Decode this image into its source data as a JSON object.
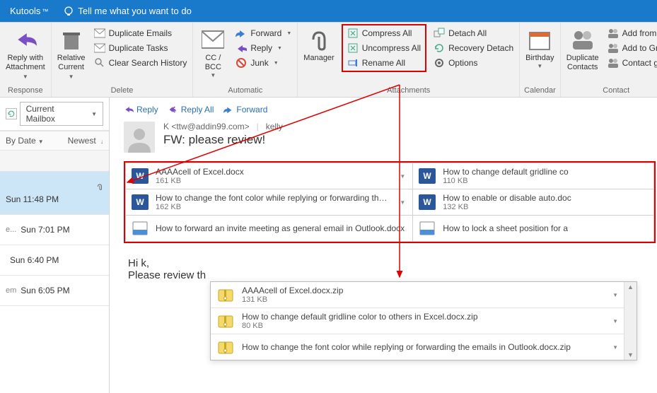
{
  "tabs": {
    "kutools": "Kutools",
    "tellme": "Tell me what you want to do"
  },
  "ribbon": {
    "response": {
      "label": "Response",
      "reply_with_attachment_l1": "Reply with",
      "reply_with_attachment_l2": "Attachment"
    },
    "delete": {
      "label": "Delete",
      "relative_current_l1": "Relative",
      "relative_current_l2": "Current",
      "duplicate_emails": "Duplicate Emails",
      "duplicate_tasks": "Duplicate Tasks",
      "clear_search_history": "Clear Search History"
    },
    "automatic": {
      "label": "Automatic",
      "ccbcc": "CC / BCC",
      "forward": "Forward",
      "reply": "Reply",
      "junk": "Junk"
    },
    "attachments": {
      "label": "Attachments",
      "manager": "Manager",
      "compress_all": "Compress All",
      "uncompress_all": "Uncompress All",
      "rename_all": "Rename All",
      "detach_all": "Detach All",
      "recovery_detach": "Recovery Detach",
      "options": "Options"
    },
    "calendar": {
      "label": "Calendar",
      "birthday": "Birthday"
    },
    "contact": {
      "label": "Contact",
      "duplicate_contacts_l1": "Duplicate",
      "duplicate_contacts_l2": "Contacts",
      "add_from": "Add from M",
      "add_to_gro": "Add to Gro",
      "contact_gro": "Contact gro"
    }
  },
  "mail_list": {
    "mailbox": "Current Mailbox",
    "sort_by": "By Date",
    "sort_dir": "Newest",
    "items": [
      {
        "time": "Sun 11:48 PM",
        "has_attach": true,
        "selected": true,
        "prefix": ""
      },
      {
        "time": "Sun 7:01 PM",
        "prefix": "e..."
      },
      {
        "time": "Sun 6:40 PM",
        "prefix": ""
      },
      {
        "time": "Sun 6:05 PM",
        "prefix": "em"
      }
    ]
  },
  "pane": {
    "reply": "Reply",
    "reply_all": "Reply All",
    "forward": "Forward",
    "from": "K <ttw@addin99.com>",
    "display": "kelly",
    "subject": "FW: please review!",
    "attachments": [
      [
        {
          "name": "AAAAcell of Excel.docx",
          "size": "161 KB",
          "type": "word",
          "chev": true
        },
        {
          "name": "How to change default gridline co",
          "size": "110 KB",
          "type": "word",
          "chev": false
        }
      ],
      [
        {
          "name": "How to change the font color while replying or forwarding the emails in Outlook.docx",
          "size": "162 KB",
          "type": "word",
          "chev": true
        },
        {
          "name": "How to enable or disable auto.doc",
          "size": "132 KB",
          "type": "word",
          "chev": false
        }
      ],
      [
        {
          "name": "How to forward an invite meeting as general email in Outlook.docx",
          "size": "",
          "type": "doc",
          "chev": false
        },
        {
          "name": "How to lock a sheet position for a",
          "size": "",
          "type": "doc",
          "chev": false
        }
      ]
    ],
    "body_l1": "Hi k,",
    "body_l2": "Please review th"
  },
  "zip": {
    "items": [
      {
        "name": "AAAAcell of Excel.docx.zip",
        "size": "131 KB"
      },
      {
        "name": "How to change default gridline color to others in Excel.docx.zip",
        "size": "80 KB"
      },
      {
        "name": "How to change the font color while replying or forwarding the emails in Outlook.docx.zip",
        "size": ""
      }
    ]
  }
}
